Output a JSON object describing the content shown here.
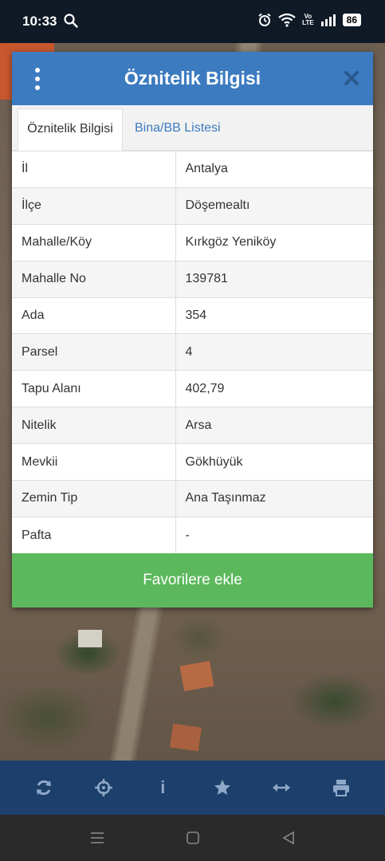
{
  "status_bar": {
    "time": "10:33",
    "battery": "86",
    "volte_top": "Vo",
    "volte_bottom": "LTE"
  },
  "modal": {
    "title": "Öznitelik Bilgisi",
    "tabs": [
      {
        "label": "Öznitelik Bilgisi",
        "active": true
      },
      {
        "label": "Bina/BB Listesi",
        "active": false
      }
    ],
    "rows": [
      {
        "key": "İl",
        "value": "Antalya"
      },
      {
        "key": "İlçe",
        "value": "Döşemealtı"
      },
      {
        "key": "Mahalle/Köy",
        "value": "Kırkgöz Yeniköy"
      },
      {
        "key": "Mahalle No",
        "value": "139781"
      },
      {
        "key": "Ada",
        "value": "354"
      },
      {
        "key": "Parsel",
        "value": "4"
      },
      {
        "key": "Tapu Alanı",
        "value": "402,79"
      },
      {
        "key": "Nitelik",
        "value": "Arsa"
      },
      {
        "key": "Mevkii",
        "value": "Gökhüyük"
      },
      {
        "key": "Zemin Tip",
        "value": "Ana Taşınmaz"
      },
      {
        "key": "Pafta",
        "value": "-"
      }
    ],
    "favorite_button": "Favorilere ekle"
  },
  "toolbar": {
    "items": [
      "refresh-icon",
      "crosshair-icon",
      "info-icon",
      "star-icon",
      "measure-icon",
      "print-icon"
    ],
    "info_glyph": "i"
  },
  "colors": {
    "header": "#3c7bc0",
    "favorite": "#5cb85c",
    "toolbar": "#1d3f6b",
    "toolbar_icon": "#8fa8c8"
  }
}
